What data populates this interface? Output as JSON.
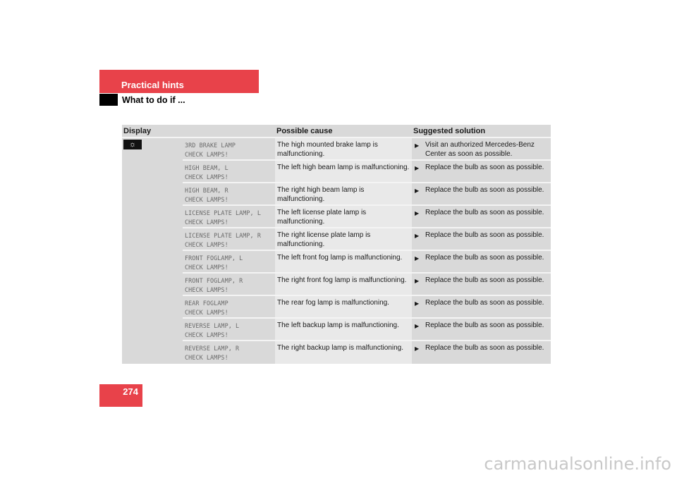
{
  "header": {
    "section": "Practical hints",
    "subsection": "What to do if ..."
  },
  "page_number": "274",
  "table": {
    "columns": [
      "Display",
      "Possible cause",
      "Suggested solution"
    ],
    "group_icon": "exterior-lamp-icon",
    "rows": [
      {
        "display1": "3RD BRAKE LAMP",
        "display2": "CHECK LAMPS!",
        "cause": "The high mounted brake lamp is malfunctioning.",
        "solution": "Visit an authorized Mercedes-Benz Center as soon as possible."
      },
      {
        "display1": "HIGH BEAM, L",
        "display2": "CHECK LAMPS!",
        "cause": "The left high beam lamp is malfunctioning.",
        "solution": "Replace the bulb as soon as possible."
      },
      {
        "display1": "HIGH BEAM, R",
        "display2": "CHECK LAMPS!",
        "cause": "The right high beam lamp is malfunctioning.",
        "solution": "Replace the bulb as soon as possible."
      },
      {
        "display1": "LICENSE PLATE LAMP, L",
        "display2": "CHECK LAMPS!",
        "cause": "The left license plate lamp is malfunctioning.",
        "solution": "Replace the bulb as soon as possible."
      },
      {
        "display1": "LICENSE PLATE LAMP, R",
        "display2": "CHECK LAMPS!",
        "cause": "The right license plate lamp is malfunctioning.",
        "solution": "Replace the bulb as soon as possible."
      },
      {
        "display1": "FRONT FOGLAMP, L",
        "display2": "CHECK LAMPS!",
        "cause": "The left front fog lamp is malfunctioning.",
        "solution": "Replace the bulb as soon as possible."
      },
      {
        "display1": "FRONT FOGLAMP, R",
        "display2": "CHECK LAMPS!",
        "cause": "The right front fog lamp is malfunctioning.",
        "solution": "Replace the bulb as soon as possible."
      },
      {
        "display1": "REAR FOGLAMP",
        "display2": "CHECK LAMPS!",
        "cause": "The rear fog lamp is malfunctioning.",
        "solution": "Replace the bulb as soon as possible."
      },
      {
        "display1": "REVERSE LAMP, L",
        "display2": "CHECK LAMPS!",
        "cause": "The left backup lamp is malfunctioning.",
        "solution": "Replace the bulb as soon as possible."
      },
      {
        "display1": "REVERSE LAMP, R",
        "display2": "CHECK LAMPS!",
        "cause": "The right backup lamp is malfunctioning.",
        "solution": "Replace the bulb as soon as possible."
      }
    ]
  },
  "watermark": "carmanualsonline.info"
}
